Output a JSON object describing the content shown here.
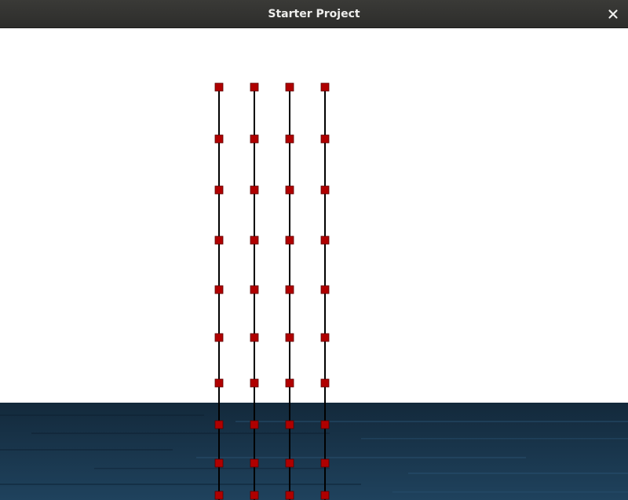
{
  "window": {
    "title": "Starter Project",
    "close_icon": "close-icon"
  },
  "scene": {
    "background_color": "#ffffff",
    "floor_color": "#1c3a52",
    "floor_highlight": "#2a5274",
    "rope_color": "#000000",
    "particle_color": "#b00000",
    "rope_count": 4,
    "particles_per_rope": 10
  }
}
